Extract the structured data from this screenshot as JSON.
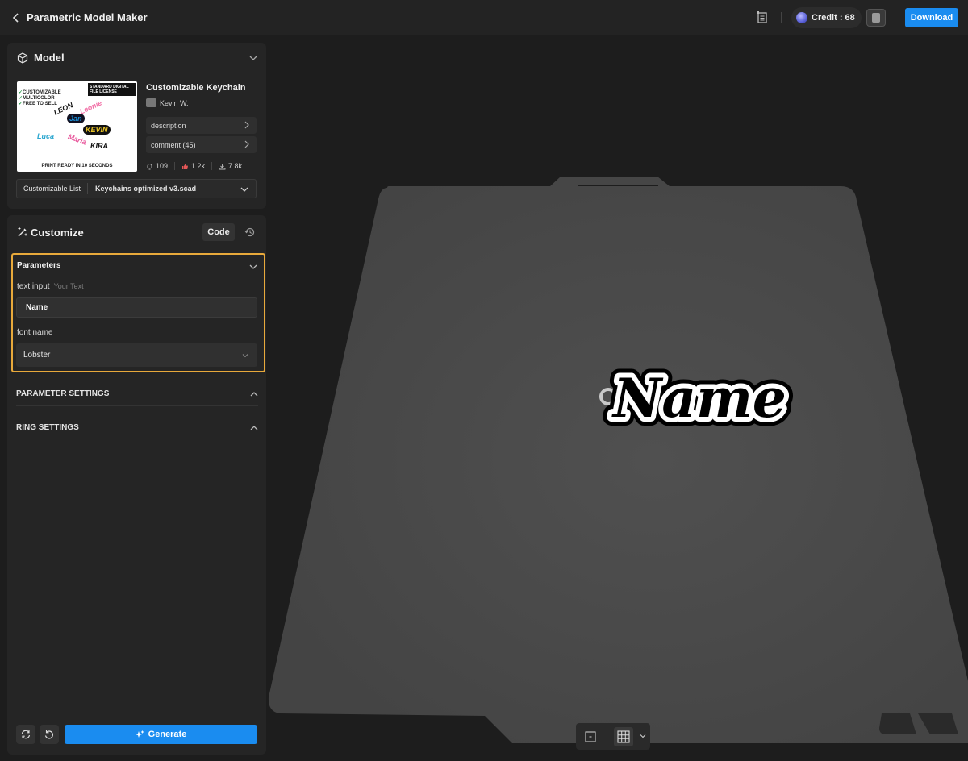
{
  "header": {
    "back_icon": "chevron-left-icon",
    "title": "Parametric Model Maker",
    "credit_label": "Credit : 68",
    "download_label": "Download"
  },
  "model_panel": {
    "title": "Model",
    "model_name": "Customizable Keychain",
    "author": "Kevin W.",
    "description_label": "description",
    "comment_label": "comment  (45)",
    "stats": {
      "likes": "109",
      "boosts": "1.2k",
      "downloads": "7.8k"
    },
    "thumbnail": {
      "features": [
        "CUSTOMIZABLE",
        "MULTICOLOR",
        "FREE TO SELL"
      ],
      "license": "STANDARD DIGITAL FILE LICENSE",
      "names": [
        "LEON",
        "Leonie",
        "Jan",
        "KEVIN",
        "Luca",
        "Maria",
        "KIRA"
      ],
      "caption": "PRINT READY IN 10 SECONDS"
    },
    "customizable_list_label": "Customizable List",
    "customizable_list_value": "Keychains optimized v3.scad"
  },
  "customize_panel": {
    "title": "Customize",
    "code_label": "Code",
    "parameters_title": "Parameters",
    "text_input_label": "text input",
    "text_input_hint": "Your Text",
    "text_input_value": "Name",
    "font_name_label": "font name",
    "font_name_value": "Lobster",
    "section_parameter_settings": "PARAMETER SETTINGS",
    "section_ring_settings": "RING SETTINGS",
    "generate_label": "Generate"
  },
  "viewport": {
    "preview_text": "Name"
  },
  "colors": {
    "accent": "#1a8cf0",
    "highlight": "#e8a93b",
    "bed": "#4a4a4a"
  }
}
